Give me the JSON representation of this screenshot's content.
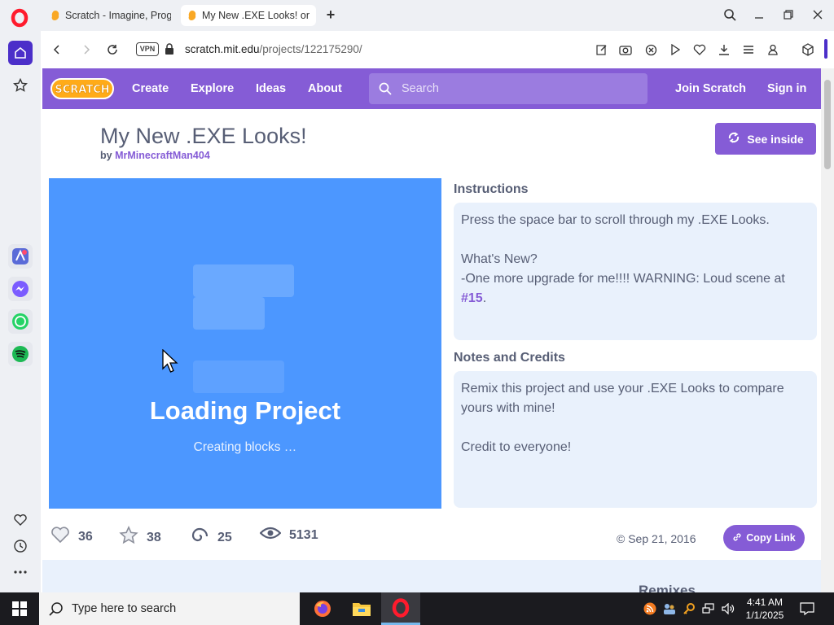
{
  "browser": {
    "tabs": [
      {
        "title": "Scratch - Imagine, Program"
      },
      {
        "title": "My New .EXE Looks! on Scratch"
      }
    ],
    "new_tab_label": "+",
    "vpn_label": "VPN",
    "url_domain": "scratch.mit.edu",
    "url_path": "/projects/122175290/"
  },
  "scratch": {
    "logo_text": "SCRATCH",
    "nav": {
      "create": "Create",
      "explore": "Explore",
      "ideas": "Ideas",
      "about": "About",
      "search_placeholder": "Search",
      "join": "Join Scratch",
      "signin": "Sign in"
    },
    "project": {
      "title": "My New .EXE Looks!",
      "by": "by",
      "author": "MrMinecraftMan404",
      "see_inside": "See inside",
      "loading": "Loading Project",
      "creating": "Creating blocks …",
      "instructions_label": "Instructions",
      "instructions_line1": "Press the space bar to scroll through my .EXE Looks.",
      "instructions_line2": "What's New?",
      "instructions_line3": "-One more upgrade for me!!!! WARNING: Loud scene at",
      "instructions_hashtag": "#15",
      "instructions_end": ".",
      "notes_label": "Notes and Credits",
      "notes_line1": "Remix this project and use your .EXE Looks to compare yours with mine!",
      "notes_line2": "Credit to everyone!",
      "loves": "36",
      "favorites": "38",
      "remixes": "25",
      "views": "5131",
      "date": "© Sep 21, 2016",
      "copy_link": "Copy Link",
      "remixes_heading_peek": "Remixes"
    },
    "colors": {
      "brand": "#855cd6",
      "stage": "#4c97ff",
      "text": "#575e75"
    }
  },
  "taskbar": {
    "search_placeholder": "Type here to search",
    "time": "4:41 AM",
    "date": "1/1/2025"
  }
}
